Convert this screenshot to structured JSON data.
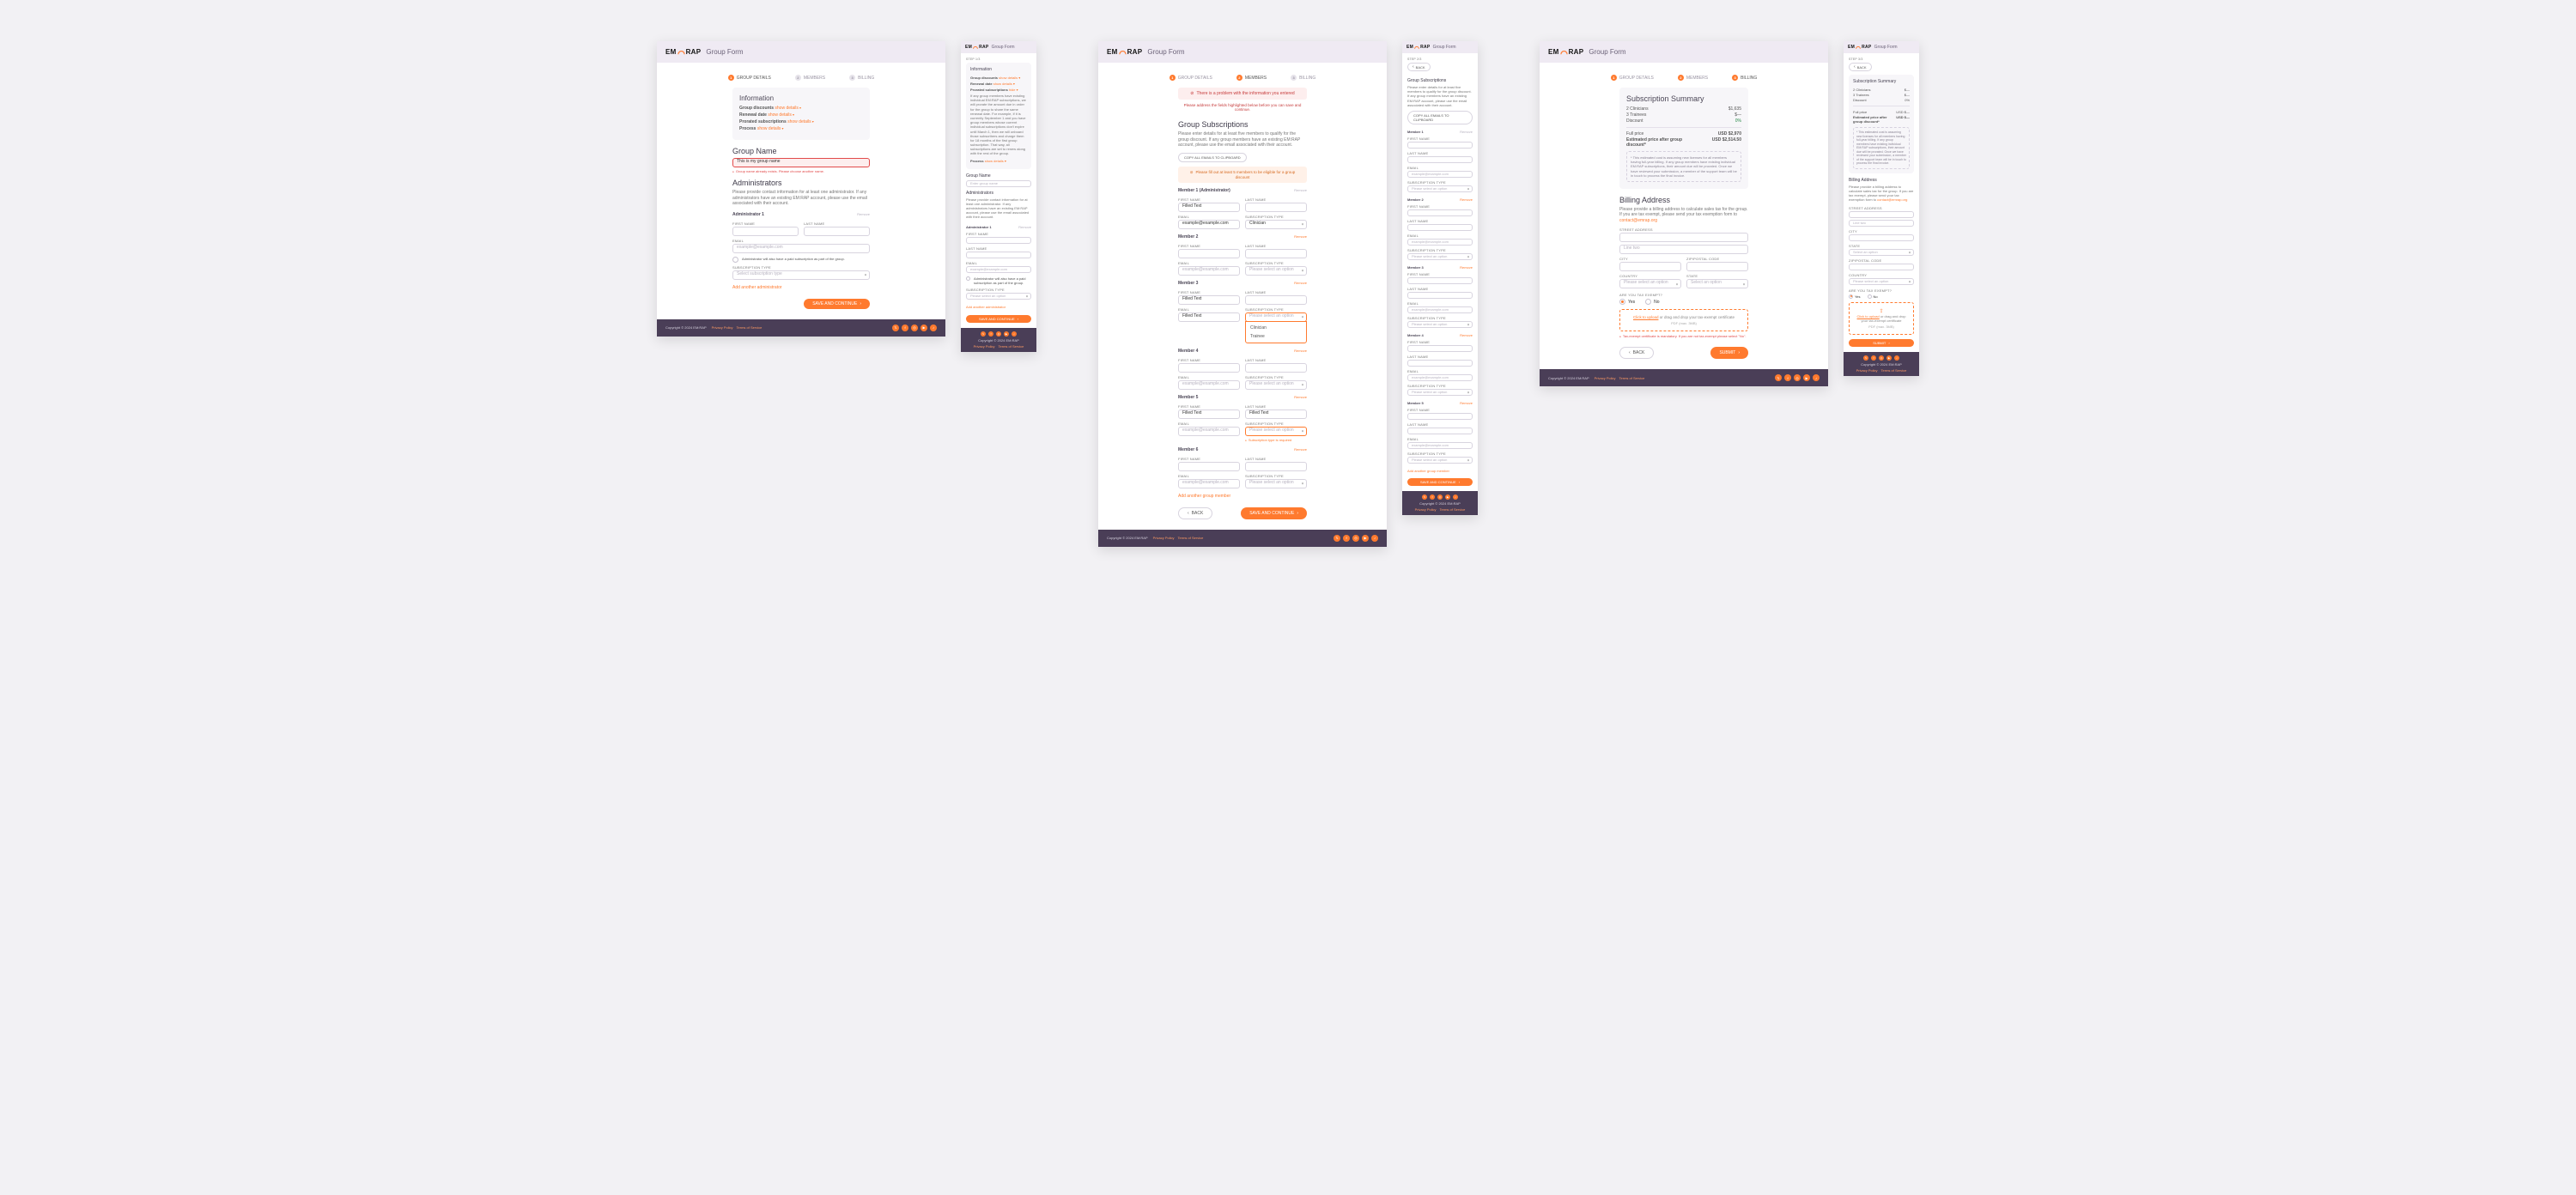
{
  "brand": {
    "em": "EM",
    "rap": "RAP",
    "form_title": "Group Form"
  },
  "steps": {
    "s1": "GROUP DETAILS",
    "s2": "MEMBERS",
    "s3": "BILLING",
    "m1": "STEP 1/3",
    "m2": "STEP 2/3",
    "m3": "STEP 3/3",
    "back": "BACK"
  },
  "info": {
    "heading": "Information",
    "discounts_lbl": "Group discounts",
    "show": "show details",
    "hide": "hide",
    "renewal_lbl": "Renewal date",
    "prorated_lbl": "Prorated subscriptions",
    "process_lbl": "Process",
    "prorated_detail": "If any group members have existing individual EM:RAP subscriptions, we will prorate the amount due in order for the group to share the same renewal date. For example, if it is currently September 1 and you have group members whose current individual subscriptions don't expire until March 1, then we will onboard those subscribers and charge them for 18 months of the first group subscription. That way, all subscriptions are set to renew along with the rest of the group."
  },
  "s1": {
    "group_name_h": "Group Name",
    "group_name_val": "This is my group name",
    "group_name_ph": "Enter group name",
    "group_name_err": "Group name already exists. Please choose another name.",
    "admins_h": "Administrators",
    "admins_hint": "Please provide contact information for at least one administrator. If any administrators have an existing EM:RAP account, please use the email associated with their account.",
    "admin1": "Administrator 1",
    "first": "FIRST NAME",
    "last": "LAST NAME",
    "email": "EMAIL",
    "email_ph": "example@example.com",
    "admin_chk": "Administrator will also have a paid subscription as part of the group.",
    "subtype": "SUBSCRIPTION TYPE",
    "subtype_ph": "Select subscription type",
    "subtype_ph2": "Please select an option",
    "add_admin": "Add another administrator",
    "save": "SAVE AND CONTINUE",
    "remove": "Remove"
  },
  "s2": {
    "problem_title": "There is a problem with the information you entered",
    "problem_sub": "Please address the fields highlighted below before you can save and continue.",
    "h": "Group Subscriptions",
    "hint": "Please enter details for at least five members to qualify for the group discount. If any group members have an existing EM:RAP account, please use the email associated with their account.",
    "copy": "COPY ALL EMAILS TO CLIPBOARD",
    "fillwarn": "Please fill out at least 5 members to be eligible for a group discount",
    "member_admin": "Member 1 (Administrator)",
    "m": "Member",
    "filled": "Filled Text",
    "opt_clinician": "Clinician",
    "opt_trainee": "Trainee",
    "subreq": "Subscription type is required",
    "add_member": "Add another group member",
    "back": "BACK",
    "save": "SAVE AND CONTINUE"
  },
  "s3": {
    "sum_h": "Subscription Summary",
    "clin": "2 Clinicians",
    "clin_v": "$1,635",
    "trn": "3 Trainees",
    "trn_v": "$—",
    "disc": "Discount",
    "disc_v": "0%",
    "full": "Full price",
    "full_v": "USD $2,970",
    "est": "Estimated price after group discount*",
    "est_v": "USD $2,514.50",
    "note": "* This estimated cost is assuming new licenses for all members having full-year billing. If any group members have existing individual EM:RAP subscriptions, their amount due will be prorated. Once we have reviewed your submission, a member of the support team will be in touch to process the final invoice.",
    "bill_h": "Billing Address",
    "bill_hint": "Please provide a billing address to calculate sales tax for the group. If you are tax exempt, please send your tax exemption form to",
    "bill_mail": "contact@emrap.org",
    "street": "STREET ADDRESS",
    "line2_ph": "Line two",
    "city": "CITY",
    "zip": "ZIP/POSTAL CODE",
    "country": "COUNTRY",
    "state": "STATE",
    "sel_ph": "Please select an option",
    "sel_ph2": "Select an option",
    "tax_q": "ARE YOU TAX EXEMPT?",
    "yes": "Yes",
    "no": "No",
    "upload": "Click to upload",
    "upload_tail": " or drag and drop your tax-exempt certificate",
    "upload_meta": "PDF (max. 3MB)",
    "cert_err": "Tax-exempt certificate is mandatory. If you are not tax-exempt please select \"No\".",
    "m_clin_v": "$—",
    "m_trn_v": "$—",
    "m_full_v": "USD $—",
    "m_est_v": "USD $—",
    "m_est_lbl": "Estimated price after group discount*",
    "back": "BACK",
    "submit": "SUBMIT"
  },
  "footer": {
    "copy": "Copyright © 2024 EM:RAP",
    "privacy": "Privacy Policy",
    "tos": "Terms of Service"
  }
}
